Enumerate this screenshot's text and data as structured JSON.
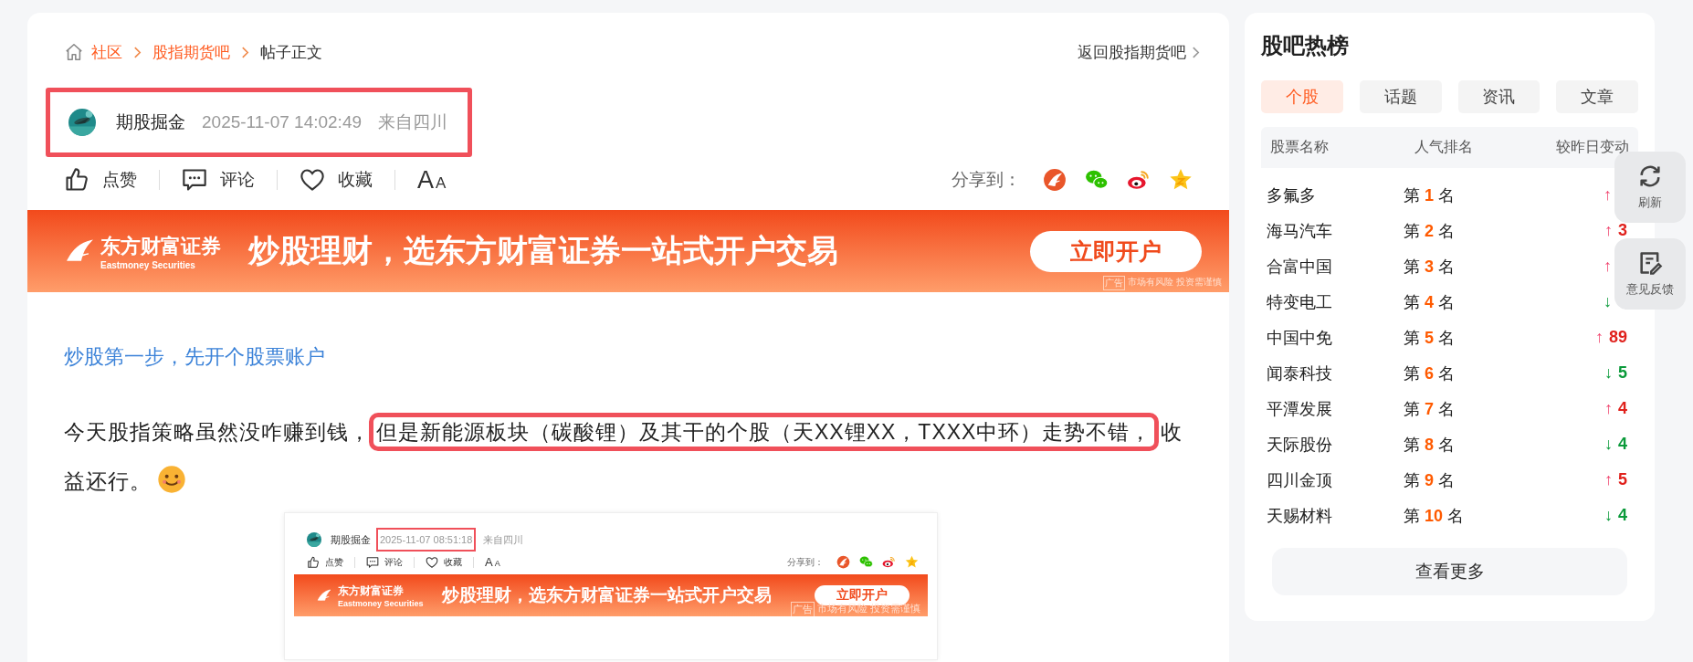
{
  "breadcrumb": {
    "items": [
      {
        "label": "社区",
        "kind": "link"
      },
      {
        "label": "股指期货吧",
        "kind": "link"
      },
      {
        "label": "帖子正文",
        "kind": "current"
      }
    ],
    "back_link": "返回股指期货吧"
  },
  "author": {
    "name": "期股掘金",
    "time": "2025-11-07 14:02:49",
    "location": "来自四川",
    "highlighted": true
  },
  "actions": [
    {
      "label": "点赞",
      "kind": "like"
    },
    {
      "label": "评论",
      "kind": "comment"
    },
    {
      "label": "收藏",
      "kind": "favorite"
    },
    {
      "label": "AA",
      "kind": "font"
    }
  ],
  "share": {
    "label": "分享到：",
    "targets": [
      {
        "kind": "eastmoney"
      },
      {
        "kind": "wechat"
      },
      {
        "kind": "weibo"
      },
      {
        "kind": "qzone"
      }
    ]
  },
  "banner": {
    "brand": "东方财富证券",
    "brand_en": "Eastmoney Securities",
    "slogan": "炒股理财，选东方财富证券一站式开户交易",
    "button": "立即开户",
    "ad_tag": "广告",
    "disclaimer": "市场有风险 投资需谨慎"
  },
  "promo_link": "炒股第一步，先开个股票账户",
  "paragraph": [
    {
      "text": "今天股指策略虽然没咋赚到钱，",
      "highlighted": false
    },
    {
      "text": "但是新能源板块（碳酸锂）及其干的个股（天XX锂XX，TXXX中环）走势不错，",
      "highlighted": true
    },
    {
      "text": "收益还行。",
      "highlighted": false
    }
  ],
  "embedded_screenshot": {
    "author": {
      "name": "期股掘金",
      "time": "2025-11-07 08:51:18",
      "location": "来自四川",
      "time_highlighted": true
    },
    "actions": [
      {
        "label": "点赞",
        "kind": "like"
      },
      {
        "label": "评论",
        "kind": "comment"
      },
      {
        "label": "收藏",
        "kind": "favorite"
      },
      {
        "label": "AA",
        "kind": "font"
      }
    ],
    "share_label": "分享到：",
    "banner": {
      "brand": "东方财富证券",
      "brand_en": "Eastmoney Securities",
      "slogan": "炒股理财，选东方财富证券一站式开户交易",
      "button": "立即开户",
      "ad_tag": "广告",
      "disclaimer": "市场有风险 投资需谨慎"
    }
  },
  "sidebar": {
    "title": "股吧热榜",
    "tabs": [
      {
        "label": "个股",
        "selected": true
      },
      {
        "label": "话题",
        "selected": false
      },
      {
        "label": "资讯",
        "selected": false
      },
      {
        "label": "文章",
        "selected": false
      }
    ],
    "columns": [
      "股票名称",
      "人气排名",
      "较昨日变动"
    ],
    "rows": [
      {
        "name": "多氟多",
        "rank_prefix": "第",
        "rank": "1",
        "rank_suffix": "名",
        "arrow": "↑",
        "rising": true
      },
      {
        "name": "海马汽车",
        "rank_prefix": "第",
        "rank": "2",
        "rank_suffix": "名",
        "arrow": "↑",
        "rising": true,
        "change": "3"
      },
      {
        "name": "合富中国",
        "rank_prefix": "第",
        "rank": "3",
        "rank_suffix": "名",
        "arrow": "↑",
        "rising": true
      },
      {
        "name": "特变电工",
        "rank_prefix": "第",
        "rank": "4",
        "rank_suffix": "名",
        "arrow": "↓",
        "rising": false
      },
      {
        "name": "中国中免",
        "rank_prefix": "第",
        "rank": "5",
        "rank_suffix": "名",
        "arrow": "↑",
        "rising": true,
        "change": "89"
      },
      {
        "name": "闻泰科技",
        "rank_prefix": "第",
        "rank": "6",
        "rank_suffix": "名",
        "arrow": "↓",
        "rising": false,
        "change": "5"
      },
      {
        "name": "平潭发展",
        "rank_prefix": "第",
        "rank": "7",
        "rank_suffix": "名",
        "arrow": "↑",
        "rising": true,
        "change": "4"
      },
      {
        "name": "天际股份",
        "rank_prefix": "第",
        "rank": "8",
        "rank_suffix": "名",
        "arrow": "↓",
        "rising": false,
        "change": "4"
      },
      {
        "name": "四川金顶",
        "rank_prefix": "第",
        "rank": "9",
        "rank_suffix": "名",
        "arrow": "↑",
        "rising": true,
        "change": "5"
      },
      {
        "name": "天赐材料",
        "rank_prefix": "第",
        "rank": "10",
        "rank_suffix": "名",
        "arrow": "↓",
        "rising": false,
        "change": "4"
      }
    ],
    "more_button": "查看更多"
  },
  "floating_buttons": [
    {
      "label": "刷新",
      "kind": "refresh"
    },
    {
      "label": "意见反馈",
      "kind": "feedback"
    }
  ]
}
